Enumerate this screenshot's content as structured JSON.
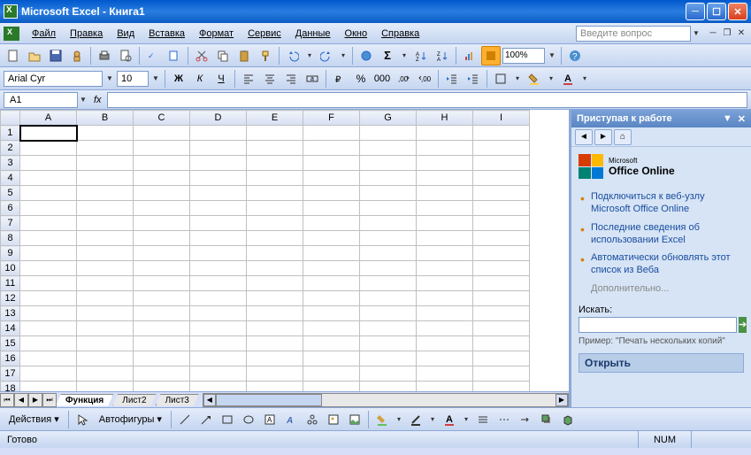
{
  "title": "Microsoft Excel - Книга1",
  "menu": [
    "Файл",
    "Правка",
    "Вид",
    "Вставка",
    "Формат",
    "Сервис",
    "Данные",
    "Окно",
    "Справка"
  ],
  "ask_placeholder": "Введите вопрос",
  "font_name": "Arial Cyr",
  "font_size": "10",
  "zoom": "100%",
  "namebox": "A1",
  "columns": [
    "A",
    "B",
    "C",
    "D",
    "E",
    "F",
    "G",
    "H",
    "I"
  ],
  "rows": [
    "1",
    "2",
    "3",
    "4",
    "5",
    "6",
    "7",
    "8",
    "9",
    "10",
    "11",
    "12",
    "13",
    "14",
    "15",
    "16",
    "17",
    "18"
  ],
  "sheettabs": [
    "Функция",
    "Лист2",
    "Лист3"
  ],
  "active_tab": 0,
  "taskpane": {
    "title": "Приступая к работе",
    "logo_small": "Microsoft",
    "logo_main": "Office Online",
    "links": [
      "Подключиться к веб-узлу Microsoft Office Online",
      "Последние сведения об использовании Excel",
      "Автоматически обновлять этот список из Веба"
    ],
    "more": "Дополнительно...",
    "search_label": "Искать:",
    "example": "Пример: \"Печать нескольких копий\"",
    "open": "Открыть"
  },
  "drawbar": {
    "actions": "Действия",
    "autoshapes": "Автофигуры"
  },
  "status": {
    "ready": "Готово",
    "num": "NUM"
  }
}
